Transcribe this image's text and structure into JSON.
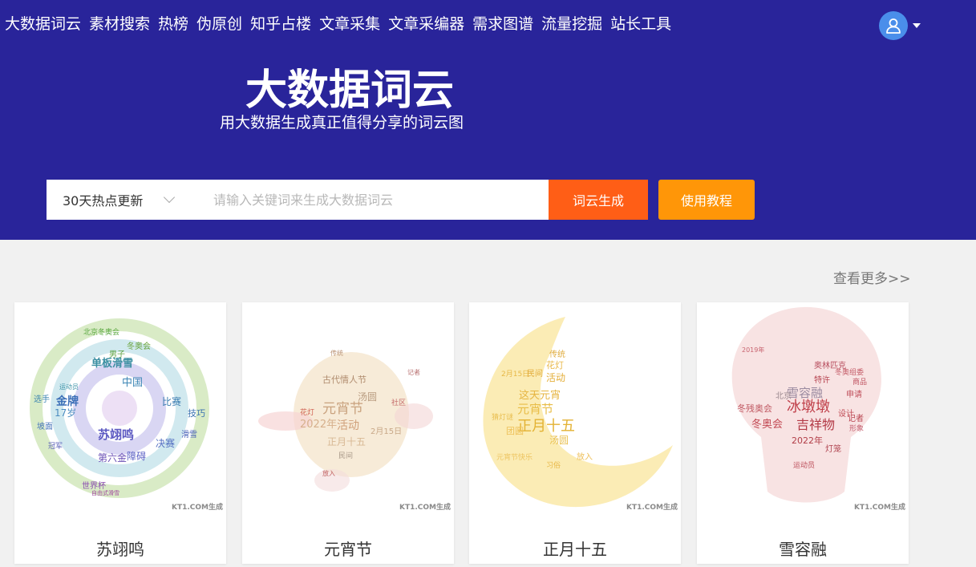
{
  "nav": {
    "items": [
      "大数据词云",
      "素材搜索",
      "热榜",
      "伪原创",
      "知乎占楼",
      "文章采集",
      "文章采编器",
      "需求图谱",
      "流量挖掘",
      "站长工具"
    ]
  },
  "hero": {
    "title": "大数据词云",
    "subtitle": "用大数据生成真正值得分享的词云图"
  },
  "search": {
    "select_value": "30天热点更新",
    "placeholder": "请输入关键词来生成大数据词云",
    "generate_label": "词云生成",
    "tutorial_label": "使用教程"
  },
  "gallery": {
    "more_label": "查看更多>>",
    "cards": [
      {
        "label": "苏翊鸣",
        "watermark": "KT1.COM生成",
        "words": [
          "北京冬奥会",
          "单板滑雪",
          "冬奥会",
          "中国",
          "金牌",
          "苏翊鸣",
          "17岁",
          "第六金",
          "障碍",
          "决赛",
          "比赛",
          "技巧",
          "滑雪",
          "世界杯",
          "男子",
          "自由式滑雪",
          "运动员",
          "选手",
          "坡面",
          "冠军"
        ]
      },
      {
        "label": "元宵节",
        "watermark": "KT1.COM生成",
        "words": [
          "古代情人节",
          "元宵节",
          "汤圆",
          "2022年",
          "活动",
          "正月十五",
          "2月15日",
          "民间",
          "花灯",
          "社区",
          "记者",
          "传统",
          "放入"
        ]
      },
      {
        "label": "正月十五",
        "watermark": "KT1.COM生成",
        "words": [
          "正月十五",
          "元宵节",
          "这天元宵",
          "汤圆",
          "放入",
          "活动",
          "花灯",
          "传统",
          "2月15日",
          "民间",
          "团圆",
          "猜灯谜",
          "元宵节快乐",
          "习俗"
        ]
      },
      {
        "label": "雪容融",
        "watermark": "KT1.COM生成",
        "words": [
          "冰墩墩",
          "雪容融",
          "吉祥物",
          "冬奥会",
          "冬残奥会",
          "2022年",
          "北京",
          "设计",
          "记者",
          "形象",
          "奥林匹克",
          "特许",
          "灯笼",
          "申请",
          "商品",
          "冬奥组委",
          "2019年",
          "运动员"
        ]
      }
    ]
  },
  "colors": {
    "hero_bg": "#29249a",
    "generate_btn": "#ff5e16",
    "tutorial_btn": "#ff9608",
    "avatar": "#4a8eea"
  }
}
